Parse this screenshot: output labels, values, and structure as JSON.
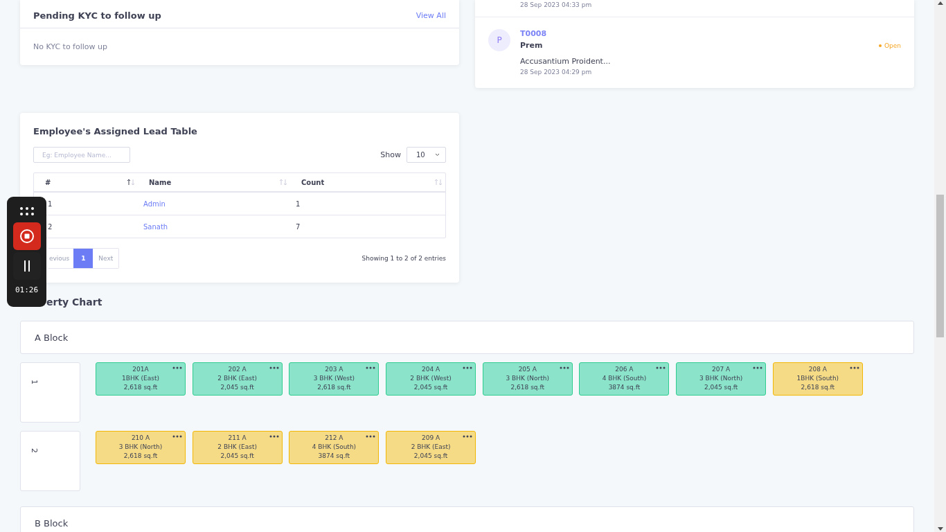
{
  "kyc_card": {
    "title": "Pending KYC to follow up",
    "view_all": "View All",
    "empty_text": "No KYC to follow up"
  },
  "tickets_card": {
    "items": [
      {
        "date": "28 Sep 2023 04:33 pm"
      },
      {
        "avatar": "P",
        "code": "T0008",
        "name": "Prem",
        "status": "Open",
        "color": "#f5a623",
        "summary": "Accusantium Proident...",
        "date": "28 Sep 2023 04:29 pm"
      }
    ]
  },
  "lead_table": {
    "title": "Employee's Assigned Lead Table",
    "search": {
      "placeholder": "Eg: Employee Name..."
    },
    "show_label": "Show",
    "page_size": "10",
    "columns": [
      {
        "label": "#",
        "sorted": true
      },
      {
        "label": "Name",
        "sorted": false
      },
      {
        "label": "Count",
        "sorted": false
      }
    ],
    "rows": [
      {
        "index": "1",
        "name": "Admin",
        "count": "1"
      },
      {
        "index": "2",
        "name": "Sanath",
        "count": "7"
      }
    ],
    "pagination": [
      {
        "label": "evious",
        "kind": "prev",
        "selected": false
      },
      {
        "label": "1",
        "kind": "page",
        "selected": true
      },
      {
        "label": "Next",
        "kind": "next",
        "selected": false
      }
    ],
    "info": "Showing 1 to 2 of 2 entries"
  },
  "property_chart": {
    "title": "erty Chart",
    "blocks": [
      {
        "name": "A Block",
        "floors": [
          {
            "label": "1",
            "units": [
              {
                "number": "201A",
                "type": "1BHK (East)",
                "area": "2,618 sq.ft",
                "color": "#8be4ca"
              },
              {
                "number": "202 A",
                "type": "2 BHK (East)",
                "area": "2,045 sq.ft",
                "color": "#8be4ca"
              },
              {
                "number": "203 A",
                "type": "3 BHK (West)",
                "area": "2,618 sq.ft",
                "color": "#8be4ca"
              },
              {
                "number": "204 A",
                "type": "2 BHK (West)",
                "area": "2,045 sq.ft",
                "color": "#8be4ca"
              },
              {
                "number": "205 A",
                "type": "3 BHK (North)",
                "area": "2,618 sq.ft",
                "color": "#8be4ca"
              },
              {
                "number": "206 A",
                "type": "4 BHK (South)",
                "area": "3874 sq.ft",
                "color": "#8be4ca"
              },
              {
                "number": "207 A",
                "type": "3 BHK (North)",
                "area": "2,045 sq.ft",
                "color": "#8be4ca"
              },
              {
                "number": "208 A",
                "type": "1BHK (South)",
                "area": "2,618 sq.ft",
                "color": "#f5db86"
              }
            ]
          },
          {
            "label": "2",
            "units": [
              {
                "number": "210 A",
                "type": "3 BHK (North)",
                "area": "2,618 sq.ft",
                "color": "#f5db86"
              },
              {
                "number": "211 A",
                "type": "2 BHK (East)",
                "area": "2,045 sq.ft",
                "color": "#f5db86"
              },
              {
                "number": "212 A",
                "type": "4 BHK (South)",
                "area": "3874 sq.ft",
                "color": "#f5db86"
              },
              {
                "number": "209 A",
                "type": "2 BHK (East)",
                "area": "2,045 sq.ft",
                "color": "#f5db86"
              }
            ]
          }
        ]
      },
      {
        "name": "B Block"
      }
    ]
  },
  "recorder": {
    "time": "01:26"
  }
}
